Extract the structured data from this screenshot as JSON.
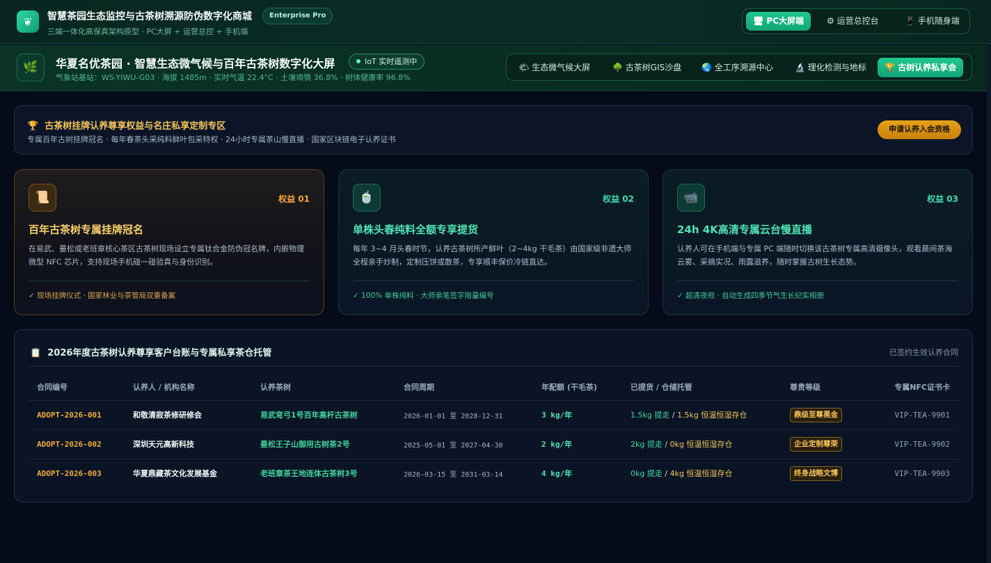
{
  "app": {
    "title": "智慧茶园生态监控与古茶树溯源防伪数字化商城",
    "edition_badge": "Enterprise Pro",
    "subtitle": "三端一体化高保真架构原型 · PC大屏 + 运营总控 + 手机端",
    "logo_icon": "tea-leaf-icon"
  },
  "mode_switch": [
    {
      "icon": "🖥",
      "label": "PC大屏端",
      "active": true
    },
    {
      "icon": "⚙",
      "label": "运营总控台",
      "active": false
    },
    {
      "icon": "📱",
      "label": "手机随身端",
      "active": false
    }
  ],
  "dashboard": {
    "icon": "🌿",
    "title": "华夏名优茶园 · 智慧生态微气候与百年古茶树数字化大屏",
    "iot_badge": "IoT 实时遥测中",
    "station_info": "气象站基站：WS-YIWU-G03 · 海拔 1485m · 实时气温 22.4°C · 土壤墒情 36.8% · 树体健康率 96.8%"
  },
  "nav_tabs": [
    {
      "icon": "🌤",
      "label": "生态微气候大屏",
      "active": false
    },
    {
      "icon": "🌳",
      "label": "古茶树GIS沙盘",
      "active": false
    },
    {
      "icon": "🌏",
      "label": "全工序溯源中心",
      "active": false
    },
    {
      "icon": "🔬",
      "label": "理化检测与地标",
      "active": false
    },
    {
      "icon": "🏆",
      "label": "古树认养私享会",
      "active": true
    }
  ],
  "banner": {
    "icon": "🏆",
    "title": "古茶树挂牌认养尊享权益与名庄私享定制专区",
    "desc": "专属百年古树挂牌冠名 · 每年春茶头采纯料鲜叶包采特权 · 24小时专属茶山慢直播 · 国家区块链电子认养证书",
    "apply_label": "申请认养入会资格"
  },
  "cards": [
    {
      "icon": "📜",
      "tag": "权益 01",
      "title": "百年古茶树专属挂牌冠名",
      "desc": "在易武、曼松或老班章核心茶区古茶树现场设立专属钛合金防伪冠名牌，内嵌物理微型 NFC 芯片，支持现场手机碰一碰验真与身份识别。",
      "foot": "✓ 现场挂牌仪式 · 国家林业与茶管局双重备案"
    },
    {
      "icon": "🍵",
      "tag": "权益 02",
      "title": "单株头春纯料全额专享提货",
      "desc": "每年 3~4 月头春时节，认养古茶树所产鲜叶（2~4kg 干毛茶）由国家级非遗大师全程亲手炒制，定制压饼或散茶，专享顺丰保价冷链直达。",
      "foot": "✓ 100% 单株纯料 · 大师亲笔签字限量编号"
    },
    {
      "icon": "📹",
      "tag": "权益 03",
      "title": "24h 4K高清专属云台慢直播",
      "desc": "认养人可在手机端与专属 PC 端随时切换该古茶树专属高清摄像头，观看晨间茶海云雾、采摘实况、雨露滋养，随时掌握古树生长态势。",
      "foot": "✓ 超清夜视 · 自动生成四季节气生长纪实相册"
    }
  ],
  "ledger": {
    "icon": "📋",
    "title": "2026年度古茶树认养尊享客户台账与专属私享茶仓托管",
    "status": "已签约生效认养合同",
    "columns": [
      "合同编号",
      "认养人 / 机构名称",
      "认养茶树",
      "合同周期",
      "年配额 (干毛茶)",
      "已提货 / 仓储托管",
      "尊贵等级",
      "专属NFC证书卡"
    ],
    "rows": [
      {
        "id": "ADOPT-2026-001",
        "name": "和敬清寂茶修研修会",
        "tree": "易武弯弓1号百年高杆古茶树",
        "period_start": "2026-01-01",
        "period_sep": "至",
        "period_end": "2028-12-31",
        "quota": "3 kg/年",
        "picked": "1.5kg 提走",
        "stored": "1.5kg 恒温恒湿存仓",
        "level": "鼎级至尊黑金",
        "nfc": "VIP-TEA-9901"
      },
      {
        "id": "ADOPT-2026-002",
        "name": "深圳天元高新科技",
        "tree": "曼松王子山御用古树茶2号",
        "period_start": "2025-05-01",
        "period_sep": "至",
        "period_end": "2027-04-30",
        "quota": "2 kg/年",
        "picked": "2kg 提走",
        "stored": "0kg 恒温恒湿存仓",
        "level": "企业定制尊荣",
        "nfc": "VIP-TEA-9902"
      },
      {
        "id": "ADOPT-2026-003",
        "name": "华夏鼎藏茶文化发展基金",
        "tree": "老班章茶王地连体古茶树3号",
        "period_start": "2026-03-15",
        "period_sep": "至",
        "period_end": "2031-03-14",
        "quota": "4 kg/年",
        "picked": "0kg 提走",
        "stored": "4kg 恒温恒湿存仓",
        "level": "终身战略文博",
        "nfc": "VIP-TEA-9903"
      }
    ]
  }
}
